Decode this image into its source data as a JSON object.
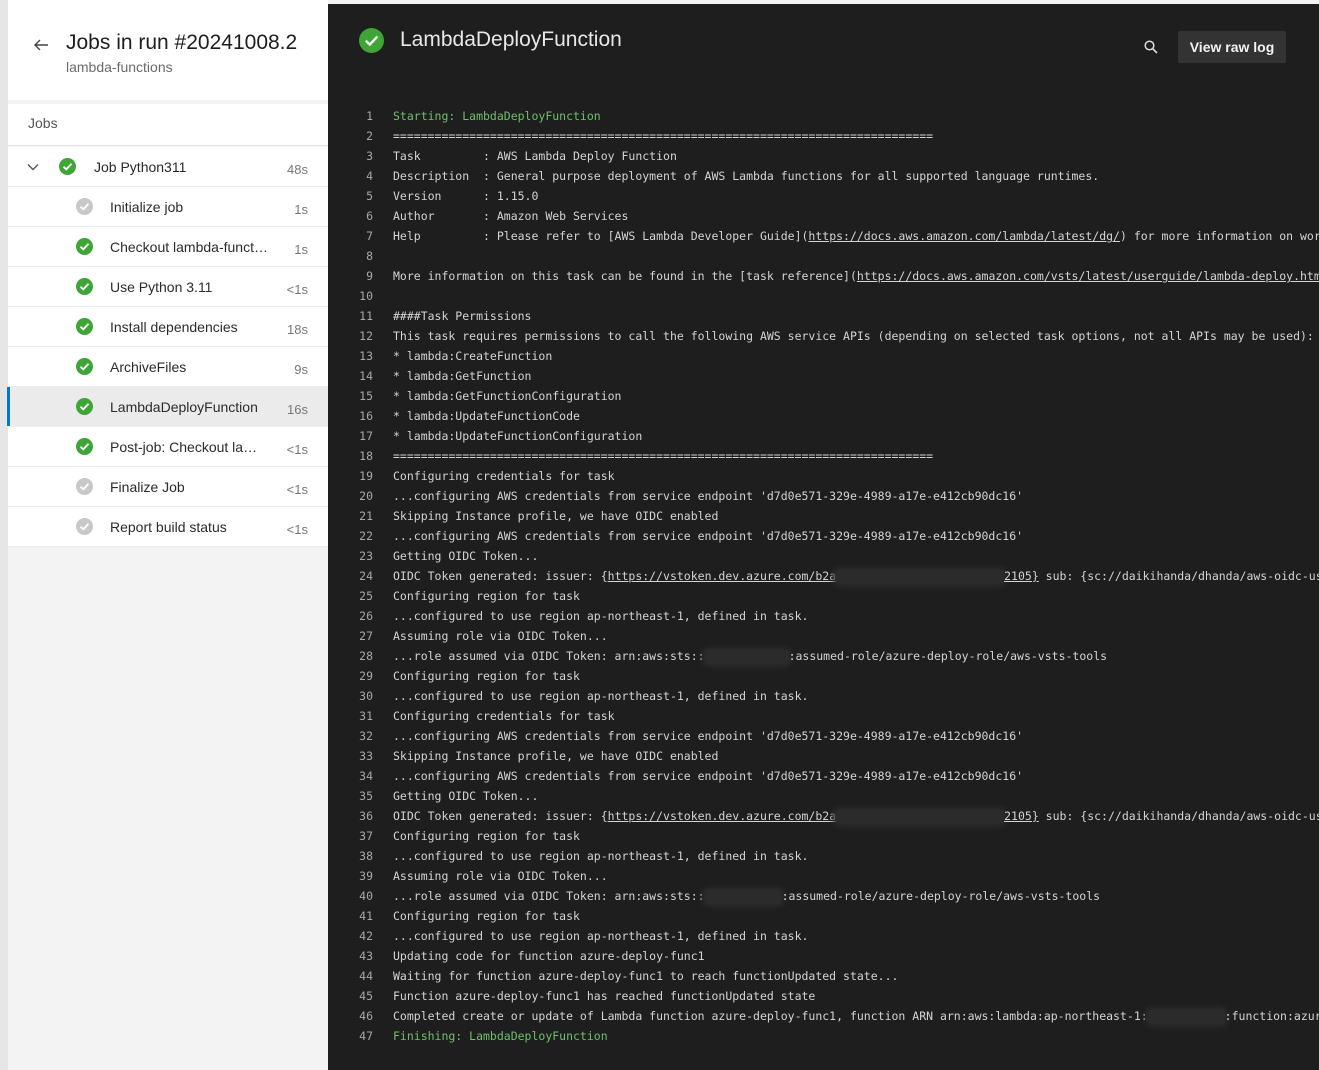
{
  "header": {
    "title": "Jobs in run #20241008.2",
    "subtitle": "lambda-functions"
  },
  "jobs_section": {
    "label": "Jobs"
  },
  "job": {
    "name": "Job Python311",
    "duration": "48s",
    "status": "succeeded"
  },
  "steps": [
    {
      "label": "Initialize job",
      "duration": "1s",
      "status": "skipped"
    },
    {
      "label": "Checkout lambda-funct…",
      "duration": "1s",
      "status": "succeeded"
    },
    {
      "label": "Use Python 3.11",
      "duration": "<1s",
      "status": "succeeded"
    },
    {
      "label": "Install dependencies",
      "duration": "18s",
      "status": "succeeded"
    },
    {
      "label": "ArchiveFiles",
      "duration": "9s",
      "status": "succeeded"
    },
    {
      "label": "LambdaDeployFunction",
      "duration": "16s",
      "status": "succeeded",
      "selected": true
    },
    {
      "label": "Post-job: Checkout la…",
      "duration": "<1s",
      "status": "succeeded"
    },
    {
      "label": "Finalize Job",
      "duration": "<1s",
      "status": "skipped"
    },
    {
      "label": "Report build status",
      "duration": "<1s",
      "status": "skipped"
    }
  ],
  "detail": {
    "title": "LambdaDeployFunction",
    "view_raw_log": "View raw log"
  },
  "colors": {
    "success": "#3fa535",
    "skipped": "#c8c8c8",
    "accent": "#0078d4",
    "log_bg": "#1e1e1e",
    "log_green": "#6cc06c"
  },
  "log": [
    {
      "n": "1",
      "green": true,
      "parts": [
        {
          "t": "Starting: LambdaDeployFunction"
        }
      ]
    },
    {
      "n": "2",
      "parts": [
        {
          "t": "=============================================================================="
        }
      ]
    },
    {
      "n": "3",
      "parts": [
        {
          "t": "Task         : AWS Lambda Deploy Function"
        }
      ]
    },
    {
      "n": "4",
      "parts": [
        {
          "t": "Description  : General purpose deployment of AWS Lambda functions for all supported language runtimes."
        }
      ]
    },
    {
      "n": "5",
      "parts": [
        {
          "t": "Version      : 1.15.0"
        }
      ]
    },
    {
      "n": "6",
      "parts": [
        {
          "t": "Author       : Amazon Web Services"
        }
      ]
    },
    {
      "n": "7",
      "parts": [
        {
          "t": "Help         : Please refer to [AWS Lambda Developer Guide]("
        },
        {
          "t": "https://docs.aws.amazon.com/lambda/latest/dg/",
          "link": true
        },
        {
          "t": ") for more information on working with"
        }
      ]
    },
    {
      "n": "8",
      "parts": [
        {
          "t": ""
        }
      ]
    },
    {
      "n": "9",
      "parts": [
        {
          "t": "More information on this task can be found in the [task reference]("
        },
        {
          "t": "https://docs.aws.amazon.com/vsts/latest/userguide/lambda-deploy.html).",
          "link": true
        }
      ]
    },
    {
      "n": "10",
      "parts": [
        {
          "t": ""
        }
      ]
    },
    {
      "n": "11",
      "parts": [
        {
          "t": "####Task Permissions"
        }
      ]
    },
    {
      "n": "12",
      "parts": [
        {
          "t": "This task requires permissions to call the following AWS service APIs (depending on selected task options, not all APIs may be used):"
        }
      ]
    },
    {
      "n": "13",
      "parts": [
        {
          "t": "* lambda:CreateFunction"
        }
      ]
    },
    {
      "n": "14",
      "parts": [
        {
          "t": "* lambda:GetFunction"
        }
      ]
    },
    {
      "n": "15",
      "parts": [
        {
          "t": "* lambda:GetFunctionConfiguration"
        }
      ]
    },
    {
      "n": "16",
      "parts": [
        {
          "t": "* lambda:UpdateFunctionCode"
        }
      ]
    },
    {
      "n": "17",
      "parts": [
        {
          "t": "* lambda:UpdateFunctionConfiguration"
        }
      ]
    },
    {
      "n": "18",
      "parts": [
        {
          "t": "=============================================================================="
        }
      ]
    },
    {
      "n": "19",
      "parts": [
        {
          "t": "Configuring credentials for task"
        }
      ]
    },
    {
      "n": "20",
      "parts": [
        {
          "t": "...configuring AWS credentials from service endpoint 'd7d0e571-329e-4989-a17e-e412cb90dc16'"
        }
      ]
    },
    {
      "n": "21",
      "parts": [
        {
          "t": "Skipping Instance profile, we have OIDC enabled"
        }
      ]
    },
    {
      "n": "22",
      "parts": [
        {
          "t": "...configuring AWS credentials from service endpoint 'd7d0e571-329e-4989-a17e-e412cb90dc16'"
        }
      ]
    },
    {
      "n": "23",
      "parts": [
        {
          "t": "Getting OIDC Token..."
        }
      ]
    },
    {
      "n": "24",
      "parts": [
        {
          "t": "OIDC Token generated: issuer: {"
        },
        {
          "t": "https://vstoken.dev.azure.com/b2a",
          "link": true
        },
        {
          "redact": 24
        },
        {
          "t": "2105}",
          "link": true
        },
        {
          "t": " sub: {sc://daikihanda/dhanda/aws-oidc-user"
        }
      ]
    },
    {
      "n": "25",
      "parts": [
        {
          "t": "Configuring region for task"
        }
      ]
    },
    {
      "n": "26",
      "parts": [
        {
          "t": "...configured to use region ap-northeast-1, defined in task."
        }
      ]
    },
    {
      "n": "27",
      "parts": [
        {
          "t": "Assuming role via OIDC Token..."
        }
      ]
    },
    {
      "n": "28",
      "parts": [
        {
          "t": "...role assumed via OIDC Token: arn:aws:sts::"
        },
        {
          "redact": 12
        },
        {
          "t": ":assumed-role/azure-deploy-role/aws-vsts-tools"
        }
      ]
    },
    {
      "n": "29",
      "parts": [
        {
          "t": "Configuring region for task"
        }
      ]
    },
    {
      "n": "30",
      "parts": [
        {
          "t": "...configured to use region ap-northeast-1, defined in task."
        }
      ]
    },
    {
      "n": "31",
      "parts": [
        {
          "t": "Configuring credentials for task"
        }
      ]
    },
    {
      "n": "32",
      "parts": [
        {
          "t": "...configuring AWS credentials from service endpoint 'd7d0e571-329e-4989-a17e-e412cb90dc16'"
        }
      ]
    },
    {
      "n": "33",
      "parts": [
        {
          "t": "Skipping Instance profile, we have OIDC enabled"
        }
      ]
    },
    {
      "n": "34",
      "parts": [
        {
          "t": "...configuring AWS credentials from service endpoint 'd7d0e571-329e-4989-a17e-e412cb90dc16'"
        }
      ]
    },
    {
      "n": "35",
      "parts": [
        {
          "t": "Getting OIDC Token..."
        }
      ]
    },
    {
      "n": "36",
      "parts": [
        {
          "t": "OIDC Token generated: issuer: {"
        },
        {
          "t": "https://vstoken.dev.azure.com/b2a",
          "link": true
        },
        {
          "redact": 24
        },
        {
          "t": "2105}",
          "link": true
        },
        {
          "t": " sub: {sc://daikihanda/dhanda/aws-oidc-user"
        }
      ]
    },
    {
      "n": "37",
      "parts": [
        {
          "t": "Configuring region for task"
        }
      ]
    },
    {
      "n": "38",
      "parts": [
        {
          "t": "...configured to use region ap-northeast-1, defined in task."
        }
      ]
    },
    {
      "n": "39",
      "parts": [
        {
          "t": "Assuming role via OIDC Token..."
        }
      ]
    },
    {
      "n": "40",
      "parts": [
        {
          "t": "...role assumed via OIDC Token: arn:aws:sts::"
        },
        {
          "redact": 11
        },
        {
          "t": ":assumed-role/azure-deploy-role/aws-vsts-tools"
        }
      ]
    },
    {
      "n": "41",
      "parts": [
        {
          "t": "Configuring region for task"
        }
      ]
    },
    {
      "n": "42",
      "parts": [
        {
          "t": "...configured to use region ap-northeast-1, defined in task."
        }
      ]
    },
    {
      "n": "43",
      "parts": [
        {
          "t": "Updating code for function azure-deploy-func1"
        }
      ]
    },
    {
      "n": "44",
      "parts": [
        {
          "t": "Waiting for function azure-deploy-func1 to reach functionUpdated state..."
        }
      ]
    },
    {
      "n": "45",
      "parts": [
        {
          "t": "Function azure-deploy-func1 has reached functionUpdated state"
        }
      ]
    },
    {
      "n": "46",
      "parts": [
        {
          "t": "Completed create or update of Lambda function azure-deploy-func1, function ARN arn:aws:lambda:ap-northeast-1:"
        },
        {
          "redact": 11
        },
        {
          "t": ":function:azure-deploy"
        }
      ]
    },
    {
      "n": "47",
      "green": true,
      "parts": [
        {
          "t": "Finishing: LambdaDeployFunction"
        }
      ]
    }
  ]
}
